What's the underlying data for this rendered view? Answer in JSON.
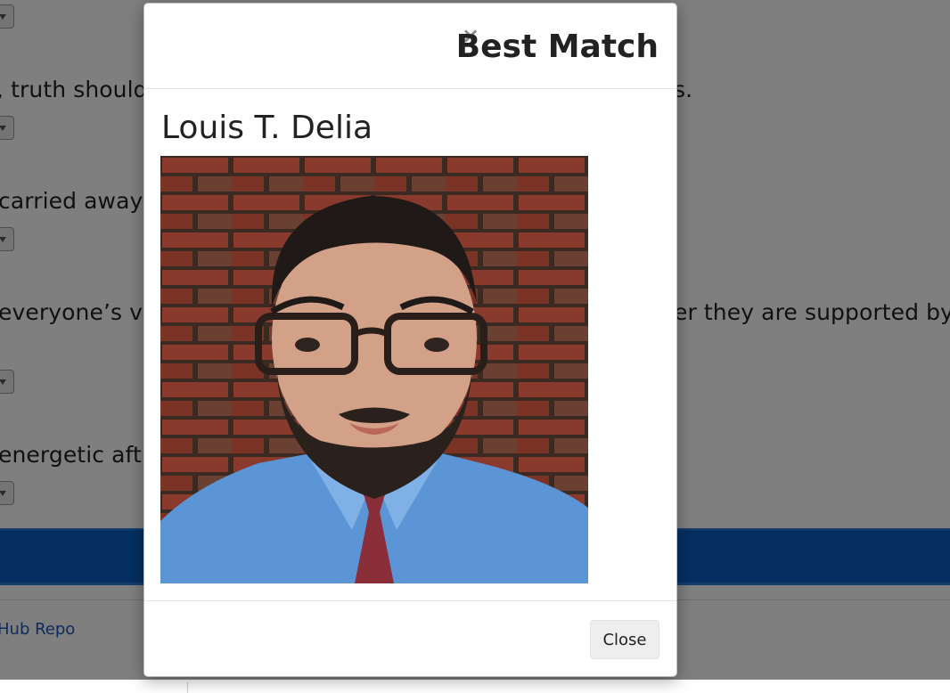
{
  "background": {
    "questions": [
      {
        "text": ", truth should"
      },
      {
        "text": "carried away"
      },
      {
        "text": "everyone’s vi"
      },
      {
        "text": "energetic aft"
      }
    ],
    "question_fragments_right": [
      {
        "text": "s."
      },
      {
        "text": "er they are supported by"
      }
    ],
    "footer_link": "Hub Repo"
  },
  "modal": {
    "close_x": "×",
    "title": "Best Match",
    "match_name": "Louis T. Delia",
    "photo_alt": "profile-photo",
    "close_button": "Close"
  },
  "colors": {
    "band_blue": "#0b5fc0",
    "link_blue": "#1f57b6",
    "backdrop": "rgba(0,0,0,0.5)"
  }
}
